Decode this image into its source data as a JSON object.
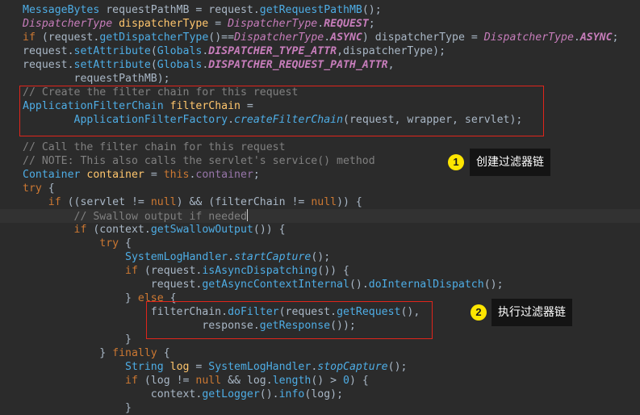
{
  "code_lines": [
    {
      "current": false,
      "tokens": [
        {
          "t": "MessageBytes ",
          "c": "type"
        },
        {
          "t": "requestPathMB",
          "c": "plain"
        },
        {
          "t": " = ",
          "c": "plain"
        },
        {
          "t": "request",
          "c": "plain"
        },
        {
          "t": ".",
          "c": "plain"
        },
        {
          "t": "getRequestPathMB",
          "c": "method"
        },
        {
          "t": "();",
          "c": "plain"
        }
      ]
    },
    {
      "current": false,
      "tokens": [
        {
          "t": "DispatcherType ",
          "c": "italic"
        },
        {
          "t": "dispatcherType",
          "c": "var"
        },
        {
          "t": " = ",
          "c": "plain"
        },
        {
          "t": "DispatcherType",
          "c": "italic"
        },
        {
          "t": ".",
          "c": "plain"
        },
        {
          "t": "REQUEST",
          "c": "const"
        },
        {
          "t": ";",
          "c": "plain"
        }
      ]
    },
    {
      "current": false,
      "tokens": [
        {
          "t": "if ",
          "c": "kw"
        },
        {
          "t": "(",
          "c": "plain"
        },
        {
          "t": "request",
          "c": "plain"
        },
        {
          "t": ".",
          "c": "plain"
        },
        {
          "t": "getDispatcherType",
          "c": "method"
        },
        {
          "t": "()==",
          "c": "plain"
        },
        {
          "t": "DispatcherType",
          "c": "italic"
        },
        {
          "t": ".",
          "c": "plain"
        },
        {
          "t": "ASYNC",
          "c": "const"
        },
        {
          "t": ") dispatcherType = ",
          "c": "plain"
        },
        {
          "t": "DispatcherType",
          "c": "italic"
        },
        {
          "t": ".",
          "c": "plain"
        },
        {
          "t": "ASYNC",
          "c": "const"
        },
        {
          "t": ";",
          "c": "plain"
        }
      ]
    },
    {
      "current": false,
      "tokens": [
        {
          "t": "request",
          "c": "plain"
        },
        {
          "t": ".",
          "c": "plain"
        },
        {
          "t": "setAttribute",
          "c": "method"
        },
        {
          "t": "(",
          "c": "plain"
        },
        {
          "t": "Globals",
          "c": "type"
        },
        {
          "t": ".",
          "c": "plain"
        },
        {
          "t": "DISPATCHER_TYPE_ATTR",
          "c": "const"
        },
        {
          "t": ",dispatcherType);",
          "c": "plain"
        }
      ]
    },
    {
      "current": false,
      "tokens": [
        {
          "t": "request",
          "c": "plain"
        },
        {
          "t": ".",
          "c": "plain"
        },
        {
          "t": "setAttribute",
          "c": "method"
        },
        {
          "t": "(",
          "c": "plain"
        },
        {
          "t": "Globals",
          "c": "type"
        },
        {
          "t": ".",
          "c": "plain"
        },
        {
          "t": "DISPATCHER_REQUEST_PATH_ATTR",
          "c": "const"
        },
        {
          "t": ",",
          "c": "plain"
        }
      ]
    },
    {
      "current": false,
      "tokens": [
        {
          "t": "        requestPathMB);",
          "c": "plain"
        }
      ]
    },
    {
      "current": false,
      "tokens": [
        {
          "t": "// Create the filter chain for this request",
          "c": "comment"
        }
      ]
    },
    {
      "current": false,
      "tokens": [
        {
          "t": "ApplicationFilterChain ",
          "c": "type"
        },
        {
          "t": "filterChain",
          "c": "var"
        },
        {
          "t": " =",
          "c": "plain"
        }
      ]
    },
    {
      "current": false,
      "tokens": [
        {
          "t": "        ",
          "c": "plain"
        },
        {
          "t": "ApplicationFilterFactory",
          "c": "type"
        },
        {
          "t": ".",
          "c": "plain"
        },
        {
          "t": "createFilterChain",
          "c": "smethod"
        },
        {
          "t": "(request, wrapper, servlet);",
          "c": "plain"
        }
      ]
    },
    {
      "current": false,
      "tokens": []
    },
    {
      "current": false,
      "tokens": [
        {
          "t": "// Call the filter chain for this request",
          "c": "comment"
        }
      ]
    },
    {
      "current": false,
      "tokens": [
        {
          "t": "// NOTE: This also calls the servlet's service() method",
          "c": "comment"
        }
      ]
    },
    {
      "current": false,
      "tokens": [
        {
          "t": "Container ",
          "c": "type"
        },
        {
          "t": "container",
          "c": "var"
        },
        {
          "t": " = ",
          "c": "plain"
        },
        {
          "t": "this",
          "c": "kw"
        },
        {
          "t": ".",
          "c": "plain"
        },
        {
          "t": "container",
          "c": "field"
        },
        {
          "t": ";",
          "c": "plain"
        }
      ]
    },
    {
      "current": false,
      "tokens": [
        {
          "t": "try ",
          "c": "kw"
        },
        {
          "t": "{",
          "c": "plain"
        }
      ]
    },
    {
      "current": false,
      "tokens": [
        {
          "t": "    ",
          "c": "plain"
        },
        {
          "t": "if ",
          "c": "kw"
        },
        {
          "t": "((servlet != ",
          "c": "plain"
        },
        {
          "t": "null",
          "c": "kw"
        },
        {
          "t": ") && (filterChain != ",
          "c": "plain"
        },
        {
          "t": "null",
          "c": "kw"
        },
        {
          "t": ")) {",
          "c": "plain"
        }
      ]
    },
    {
      "current": true,
      "caret": true,
      "tokens": [
        {
          "t": "        ",
          "c": "plain"
        },
        {
          "t": "// Swallow output if needed",
          "c": "comment"
        }
      ]
    },
    {
      "current": false,
      "tokens": [
        {
          "t": "        ",
          "c": "plain"
        },
        {
          "t": "if ",
          "c": "kw"
        },
        {
          "t": "(context.",
          "c": "plain"
        },
        {
          "t": "getSwallowOutput",
          "c": "method"
        },
        {
          "t": "()) {",
          "c": "plain"
        }
      ]
    },
    {
      "current": false,
      "tokens": [
        {
          "t": "            ",
          "c": "plain"
        },
        {
          "t": "try ",
          "c": "kw"
        },
        {
          "t": "{",
          "c": "plain"
        }
      ]
    },
    {
      "current": false,
      "tokens": [
        {
          "t": "                ",
          "c": "plain"
        },
        {
          "t": "SystemLogHandler",
          "c": "type"
        },
        {
          "t": ".",
          "c": "plain"
        },
        {
          "t": "startCapture",
          "c": "smethod"
        },
        {
          "t": "();",
          "c": "plain"
        }
      ]
    },
    {
      "current": false,
      "tokens": [
        {
          "t": "                ",
          "c": "plain"
        },
        {
          "t": "if ",
          "c": "kw"
        },
        {
          "t": "(request.",
          "c": "plain"
        },
        {
          "t": "isAsyncDispatching",
          "c": "method"
        },
        {
          "t": "()) {",
          "c": "plain"
        }
      ]
    },
    {
      "current": false,
      "tokens": [
        {
          "t": "                    request.",
          "c": "plain"
        },
        {
          "t": "getAsyncContextInternal",
          "c": "method"
        },
        {
          "t": "().",
          "c": "plain"
        },
        {
          "t": "doInternalDispatch",
          "c": "method"
        },
        {
          "t": "();",
          "c": "plain"
        }
      ]
    },
    {
      "current": false,
      "tokens": [
        {
          "t": "                } ",
          "c": "plain"
        },
        {
          "t": "else ",
          "c": "kw"
        },
        {
          "t": "{",
          "c": "plain"
        }
      ]
    },
    {
      "current": false,
      "tokens": [
        {
          "t": "                    filterChain.",
          "c": "plain"
        },
        {
          "t": "doFilter",
          "c": "method"
        },
        {
          "t": "(request.",
          "c": "plain"
        },
        {
          "t": "getRequest",
          "c": "method"
        },
        {
          "t": "(),",
          "c": "plain"
        }
      ]
    },
    {
      "current": false,
      "tokens": [
        {
          "t": "                            response.",
          "c": "plain"
        },
        {
          "t": "getResponse",
          "c": "method"
        },
        {
          "t": "());",
          "c": "plain"
        }
      ]
    },
    {
      "current": false,
      "tokens": [
        {
          "t": "                }",
          "c": "plain"
        }
      ]
    },
    {
      "current": false,
      "tokens": [
        {
          "t": "            } ",
          "c": "plain"
        },
        {
          "t": "finally ",
          "c": "kw"
        },
        {
          "t": "{",
          "c": "plain"
        }
      ]
    },
    {
      "current": false,
      "tokens": [
        {
          "t": "                ",
          "c": "plain"
        },
        {
          "t": "String ",
          "c": "type"
        },
        {
          "t": "log",
          "c": "var"
        },
        {
          "t": " = ",
          "c": "plain"
        },
        {
          "t": "SystemLogHandler",
          "c": "type"
        },
        {
          "t": ".",
          "c": "plain"
        },
        {
          "t": "stopCapture",
          "c": "smethod"
        },
        {
          "t": "();",
          "c": "plain"
        }
      ]
    },
    {
      "current": false,
      "tokens": [
        {
          "t": "                ",
          "c": "plain"
        },
        {
          "t": "if ",
          "c": "kw"
        },
        {
          "t": "(log != ",
          "c": "plain"
        },
        {
          "t": "null ",
          "c": "kw"
        },
        {
          "t": "&& log.",
          "c": "plain"
        },
        {
          "t": "length",
          "c": "method"
        },
        {
          "t": "() > ",
          "c": "plain"
        },
        {
          "t": "0",
          "c": "type"
        },
        {
          "t": ") {",
          "c": "plain"
        }
      ]
    },
    {
      "current": false,
      "tokens": [
        {
          "t": "                    context.",
          "c": "plain"
        },
        {
          "t": "getLogger",
          "c": "method"
        },
        {
          "t": "().",
          "c": "plain"
        },
        {
          "t": "info",
          "c": "method"
        },
        {
          "t": "(log);",
          "c": "plain"
        }
      ]
    },
    {
      "current": false,
      "tokens": [
        {
          "t": "                }",
          "c": "plain"
        }
      ]
    }
  ],
  "callouts": [
    {
      "number": "1",
      "label": "创建过滤器链"
    },
    {
      "number": "2",
      "label": "执行过滤器链"
    }
  ],
  "colors": {
    "background": "#2b2b2b",
    "highlight_box": "#e0251b",
    "badge": "#ffe600",
    "label_bg": "#141414"
  }
}
